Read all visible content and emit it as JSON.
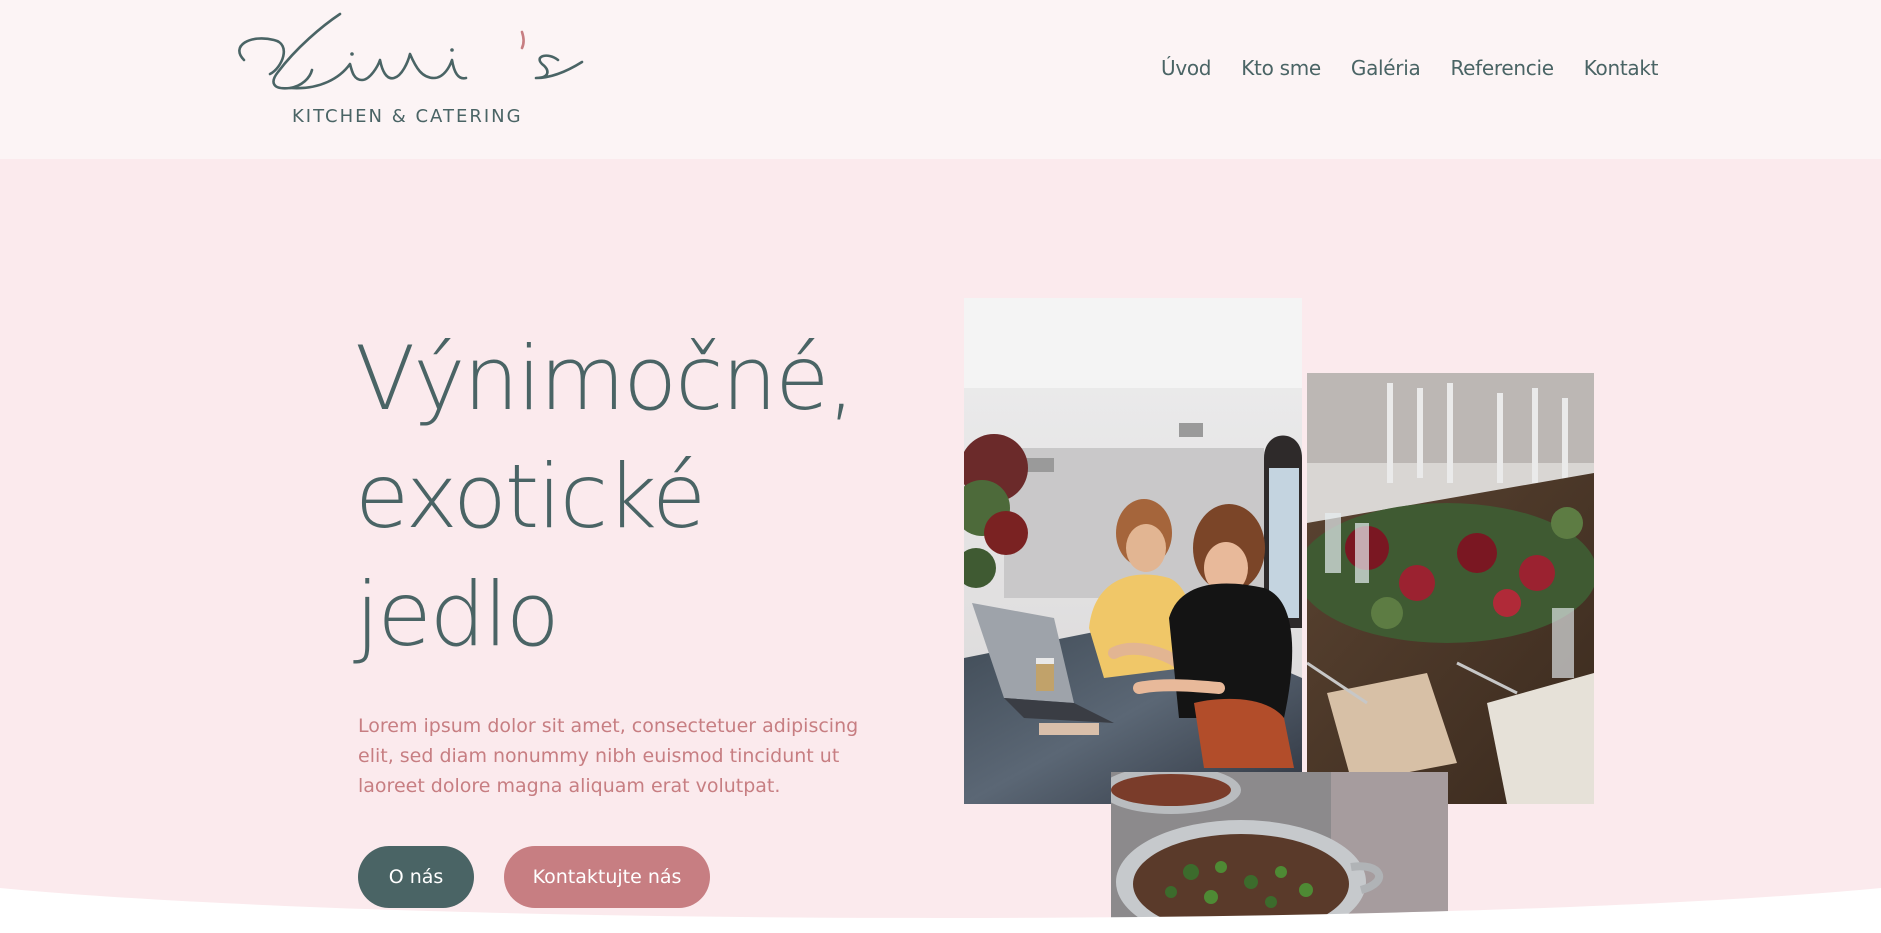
{
  "brand": {
    "script_name": "Livi's",
    "tagline": "KITCHEN & CATERING"
  },
  "nav": {
    "items": [
      {
        "label": "Úvod"
      },
      {
        "label": "Kto sme"
      },
      {
        "label": "Galéria"
      },
      {
        "label": "Referencie"
      },
      {
        "label": "Kontakt"
      }
    ]
  },
  "hero": {
    "title_lines": [
      "Výnimočné,",
      "exotické",
      "jedlo"
    ],
    "text": "Lorem ipsum dolor sit amet, consectetuer adipiscing elit, sed diam nonummy nibh euismod tincidunt ut laoreet dolore magna aliquam erat volutpat.",
    "primary_button": "O nás",
    "secondary_button": "Kontaktujte nás"
  },
  "colors": {
    "primary": "#4a6465",
    "accent": "#c77e82",
    "background": "#fbeaed",
    "header_background": "#fcf4f5"
  },
  "images": [
    {
      "name": "photo-women-laptop"
    },
    {
      "name": "photo-table-setting"
    },
    {
      "name": "photo-food-pot"
    }
  ]
}
